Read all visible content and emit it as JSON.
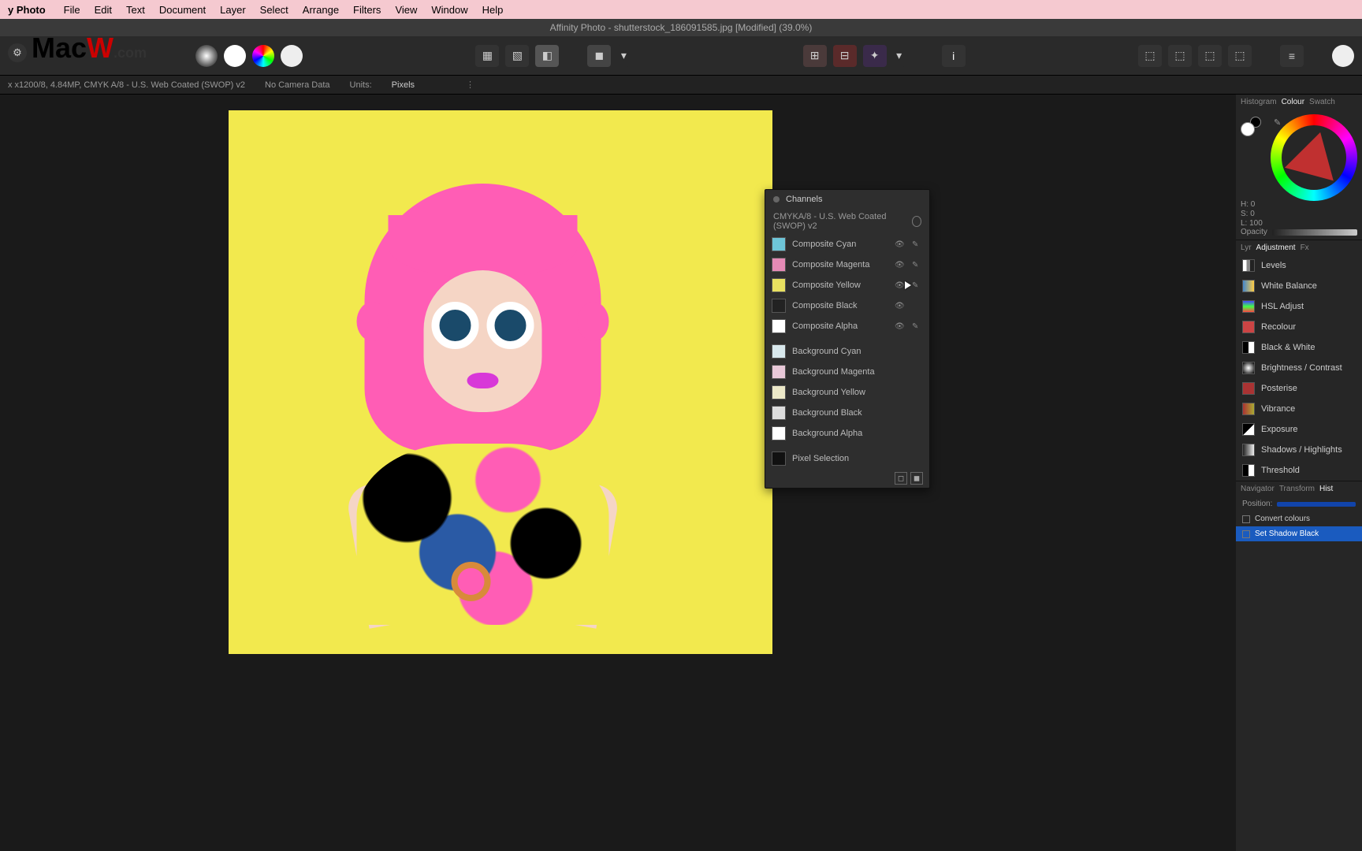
{
  "menubar": {
    "app": "y Photo",
    "items": [
      "File",
      "Edit",
      "Text",
      "Document",
      "Layer",
      "Select",
      "Arrange",
      "Filters",
      "View",
      "Window",
      "Help"
    ]
  },
  "logo": {
    "part1": "Mac",
    "part2": "W",
    "part3": ".com"
  },
  "titlebar": "Affinity Photo - shutterstock_186091585.jpg [Modified] (39.0%)",
  "infobar": {
    "doc": "x x1200/8, 4.84MP, CMYK A/8 - U.S. Web Coated (SWOP) v2",
    "camera": "No Camera Data",
    "units_label": "Units:",
    "units_value": "Pixels"
  },
  "channels": {
    "title": "Channels",
    "profile": "CMYKA/8 - U.S. Web Coated (SWOP) v2",
    "rows": [
      {
        "swatch": "sw-cyan",
        "label": "Composite Cyan",
        "eye": true,
        "pen": true
      },
      {
        "swatch": "sw-mag",
        "label": "Composite Magenta",
        "eye": true,
        "pen": true
      },
      {
        "swatch": "sw-yel",
        "label": "Composite Yellow",
        "eye": true,
        "pen": true
      },
      {
        "swatch": "sw-blk",
        "label": "Composite Black",
        "eye": true,
        "pen": false
      },
      {
        "swatch": "sw-alpha",
        "label": "Composite Alpha",
        "eye": true,
        "pen": true
      }
    ],
    "rows2": [
      {
        "swatch": "sw-bcyan",
        "label": "Background Cyan"
      },
      {
        "swatch": "sw-bmag",
        "label": "Background Magenta"
      },
      {
        "swatch": "sw-byel",
        "label": "Background Yellow"
      },
      {
        "swatch": "sw-bblk",
        "label": "Background Black"
      },
      {
        "swatch": "sw-balpha",
        "label": "Background Alpha"
      }
    ],
    "pixel": "Pixel Selection"
  },
  "right": {
    "tabs_top": [
      "Histogram",
      "Colour",
      "Swatch"
    ],
    "tabs_top_active": 1,
    "hsl": {
      "h": "H: 0",
      "s": "S: 0",
      "l": "L: 100"
    },
    "opacity_label": "Opacity",
    "tabs_adj": [
      "Lyr",
      "Adjustment",
      "Fx"
    ],
    "tabs_adj_active": 1,
    "adjustments": [
      {
        "ic": "ic-lvl",
        "label": "Levels"
      },
      {
        "ic": "ic-wb",
        "label": "White Balance"
      },
      {
        "ic": "ic-hsl",
        "label": "HSL Adjust"
      },
      {
        "ic": "ic-rec",
        "label": "Recolour"
      },
      {
        "ic": "ic-bw",
        "label": "Black & White"
      },
      {
        "ic": "ic-bc",
        "label": "Brightness / Contrast"
      },
      {
        "ic": "ic-pos",
        "label": "Posterise"
      },
      {
        "ic": "ic-vib",
        "label": "Vibrance"
      },
      {
        "ic": "ic-exp",
        "label": "Exposure"
      },
      {
        "ic": "ic-sh",
        "label": "Shadows / Highlights"
      },
      {
        "ic": "ic-thr",
        "label": "Threshold"
      }
    ],
    "tabs_nav": [
      "Navigator",
      "Transform",
      "Hist"
    ],
    "tabs_nav_active": 2,
    "position_label": "Position:",
    "history": [
      {
        "label": "Convert colours",
        "sel": false
      },
      {
        "label": "Set Shadow Black",
        "sel": true
      }
    ]
  }
}
